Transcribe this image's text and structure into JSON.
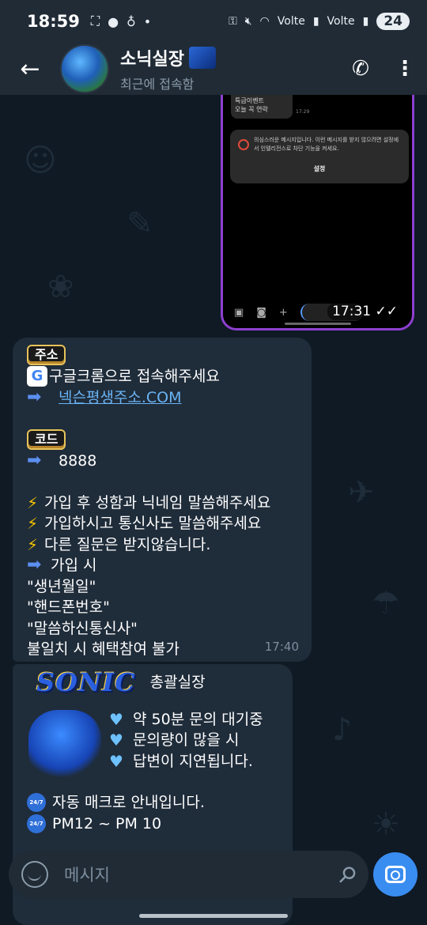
{
  "status_bar": {
    "time": "18:59",
    "left_icons": [
      "screenshot-icon",
      "talk-icon",
      "notification-icon",
      "dot-icon"
    ],
    "right_icons": [
      "key-icon",
      "mute-icon",
      "wifi-icon",
      "signal-icon",
      "signal-icon"
    ],
    "battery": "24",
    "lte_label": "Volte"
  },
  "header": {
    "title": "소닉실장",
    "status": "최근에 접속함"
  },
  "photo_message": {
    "sms_text_line1": "특급이벤트",
    "sms_text_line2": "오늘 꼭 연락",
    "sms_time": "17:29",
    "warning_text": "의심스러운 메시지입니다. 이런 메시지를 받지 않으려면 설정에서 인텔리전스로 차단 기능을 켜세요.",
    "warning_button": "설정",
    "time": "17:31"
  },
  "message_1": {
    "address_badge": "주소",
    "chrome_text": "구글크롬으로 접속해주세요",
    "link_text": "넥슨평생주소.COM",
    "code_badge": "코드",
    "code_value": "8888",
    "rule_1": "가입 후 성함과 닉네임 말씀해주세요",
    "rule_2": "가입하시고 통신사도 말씀해주세요",
    "rule_3": "다른 질문은 받지않습니다.",
    "signup_label": "가입 시",
    "req_1": "\"생년월일\"",
    "req_2": "\"핸드폰번호\"",
    "req_3": "\"말씀하신통신사\"",
    "mismatch": "불일치 시 혜택참여 불가",
    "time": "17:40"
  },
  "message_2": {
    "logo": "SONIC",
    "manager": "총괄실장",
    "wait_1": "약 50분 문의 대기중",
    "wait_2": "문의량이 많을 시",
    "wait_3": "답변이 지연됩니다.",
    "clock_label": "24/7",
    "macro": "자동 매크로 안내입니다.",
    "hours": "PM12 ~ PM 10"
  },
  "input": {
    "placeholder": "메시지"
  }
}
